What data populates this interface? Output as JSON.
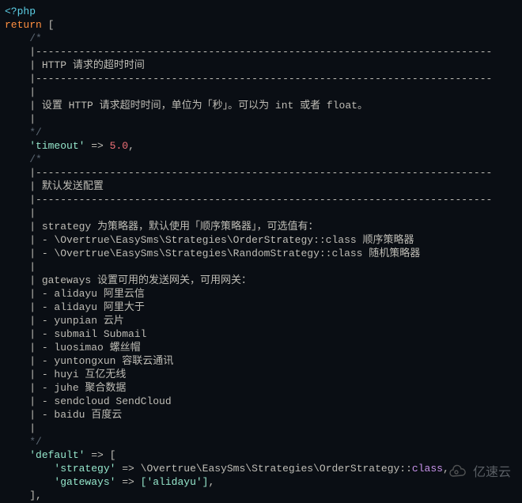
{
  "code": {
    "open_tag": "<?php",
    "return_kw": "return",
    "open_bracket": " [",
    "comment_open": "/*",
    "dash_line": "|--------------------------------------------------------------------------",
    "block1_title": "| HTTP 请求的超时时间",
    "pipe_only": "|",
    "block1_desc": "| 设置 HTTP 请求超时时间，单位为「秒」。可以为 int 或者 float。",
    "comment_close": "*/",
    "timeout_key": "'timeout'",
    "arrow": " => ",
    "timeout_val": "5.0",
    "comma": ",",
    "block2_title": "| 默认发送配置",
    "strategy_intro": "| strategy 为策略器，默认使用「顺序策略器」，可选值有：",
    "order_strategy": "| - \\Overtrue\\EasySms\\Strategies\\OrderStrategy::class 顺序策略器",
    "random_strategy": "| - \\Overtrue\\EasySms\\Strategies\\RandomStrategy::class 随机策略器",
    "gateways_intro": "| gateways 设置可用的发送网关，可用网关：",
    "gw_alidayu1": "| - alidayu 阿里云信",
    "gw_alidayu2": "| - alidayu 阿里大于",
    "gw_yunpian": "| - yunpian 云片",
    "gw_submail": "| - submail Submail",
    "gw_luosimao": "| - luosimao 螺丝帽",
    "gw_yuntongxun": "| - yuntongxun 容联云通讯",
    "gw_huyi": "| - huyi 互亿无线",
    "gw_juhe": "| - juhe 聚合数据",
    "gw_sendcloud": "| - sendcloud SendCloud",
    "gw_baidu": "| - baidu 百度云",
    "default_key": "'default'",
    "sub_open": " => [",
    "strategy_key": "'strategy'",
    "strategy_ns": "\\Overtrue\\EasySms\\Strategies\\OrderStrategy::",
    "class_kw": "class",
    "gateways_key": "'gateways'",
    "gateways_val": "['alidayu']",
    "close_sub": "],"
  },
  "watermark": "亿速云"
}
